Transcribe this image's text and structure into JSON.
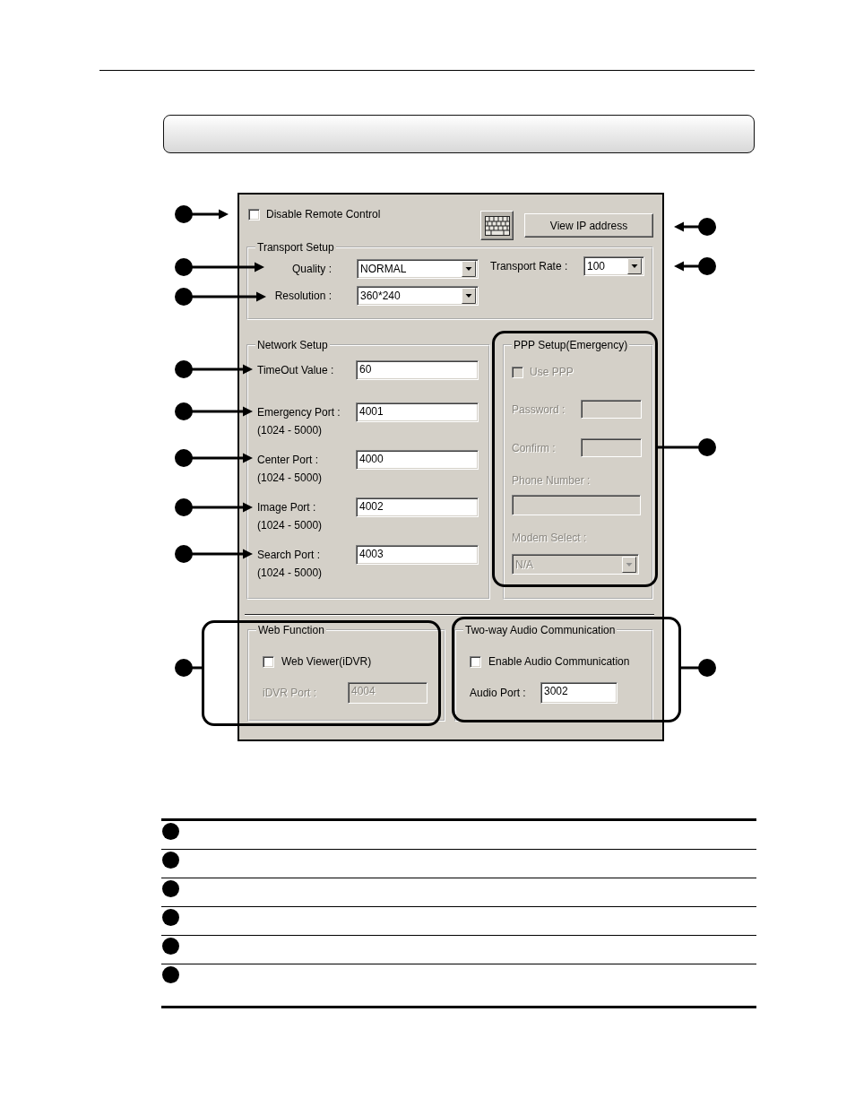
{
  "dialog": {
    "disable_remote_control": {
      "label": "Disable Remote Control",
      "checked": false
    },
    "buttons": [
      {
        "kind": "keyboard"
      },
      {
        "kind": "text",
        "label": "View IP address"
      }
    ],
    "transport_setup": {
      "title": "Transport Setup",
      "highlighted": false,
      "fields": [
        {
          "label": "Quality :",
          "value": "NORMAL"
        },
        {
          "label": "Resolution :",
          "value": "360*240"
        }
      ],
      "rate": {
        "label": "Transport Rate :",
        "value": "100"
      }
    },
    "network_setup": {
      "title": "Network Setup",
      "highlighted": false,
      "fields": [
        {
          "label": "TimeOut Value :",
          "value": "60"
        },
        {
          "label": "Emergency Port :",
          "range": "(1024 - 5000)",
          "value": "4001"
        },
        {
          "label": "Center Port :",
          "range": "(1024 - 5000)",
          "value": "4000"
        },
        {
          "label": "Image Port :",
          "range": "(1024 - 5000)",
          "value": "4002"
        },
        {
          "label": "Search Port :",
          "range": "(1024 - 5000)",
          "value": "4003"
        }
      ]
    },
    "ppp_setup": {
      "title": "PPP Setup(Emergency)",
      "highlighted": true,
      "disabled": true,
      "use_ppp": {
        "label": "Use PPP",
        "checked": false
      },
      "password": {
        "label": "Password :"
      },
      "confirm": {
        "label": "Confirm :"
      },
      "phone_number": {
        "label": "Phone Number :"
      },
      "modem_select": {
        "label": "Modem Select :",
        "value": "N/A"
      }
    },
    "web_function": {
      "title": "Web Function",
      "highlighted": true,
      "web_viewer": {
        "label": "Web Viewer(iDVR)",
        "checked": false
      },
      "idvr_port": {
        "label": "iDVR Port :",
        "value": "4004",
        "disabled": true
      }
    },
    "audio": {
      "title": "Two-way Audio Communication",
      "highlighted": true,
      "enable_audio": {
        "label": "Enable Audio Communication",
        "checked": false
      },
      "audio_port": {
        "label": "Audio Port :",
        "value": "3002",
        "disabled": false
      }
    }
  },
  "callouts": [
    {
      "kind": "arrow"
    },
    {
      "kind": "arrow"
    },
    {
      "kind": "arrow"
    },
    {
      "kind": "arrow"
    },
    {
      "kind": "arrow"
    },
    {
      "kind": "arrow"
    },
    {
      "kind": "arrow"
    },
    {
      "kind": "arrow"
    },
    {
      "kind": "line"
    },
    {
      "kind": "arrow"
    },
    {
      "kind": "arrow"
    },
    {
      "kind": "line"
    },
    {
      "kind": "line"
    }
  ],
  "legend_table": {
    "rows": [
      {
        "kind": "bullet"
      },
      {
        "kind": "bullet"
      },
      {
        "kind": "bullet"
      },
      {
        "kind": "bullet"
      },
      {
        "kind": "bullet"
      },
      {
        "kind": "bullet"
      }
    ]
  }
}
